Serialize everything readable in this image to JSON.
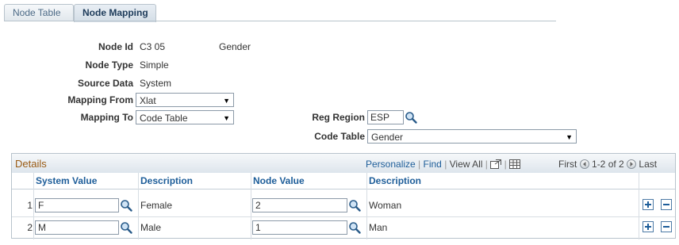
{
  "tabs": [
    {
      "label": "Node Table",
      "active": false
    },
    {
      "label": "Node Mapping",
      "active": true
    }
  ],
  "form": {
    "node_id_label": "Node Id",
    "node_id_value": "C3 05",
    "node_name": "Gender",
    "node_type_label": "Node Type",
    "node_type_value": "Simple",
    "source_data_label": "Source Data",
    "source_data_value": "System",
    "mapping_from_label": "Mapping From",
    "mapping_from_value": "Xlat",
    "mapping_to_label": "Mapping To",
    "mapping_to_value": "Code Table",
    "reg_region_label": "Reg Region",
    "reg_region_value": "ESP",
    "code_table_label": "Code Table",
    "code_table_value": "Gender"
  },
  "grid": {
    "title": "Details",
    "personalize": "Personalize",
    "find": "Find",
    "view_all": "View All",
    "first": "First",
    "range": "1-2 of 2",
    "last": "Last",
    "columns": [
      "System Value",
      "Description",
      "Node Value",
      "Description"
    ],
    "rows": [
      {
        "num": "1",
        "system_value": "F",
        "description": "Female",
        "node_value": "2",
        "node_description": "Woman"
      },
      {
        "num": "2",
        "system_value": "M",
        "description": "Male",
        "node_value": "1",
        "node_description": "Man"
      }
    ]
  },
  "colors": {
    "link": "#1d5d99",
    "grid_title": "#9a5a12",
    "border": "#b8c3cc"
  }
}
